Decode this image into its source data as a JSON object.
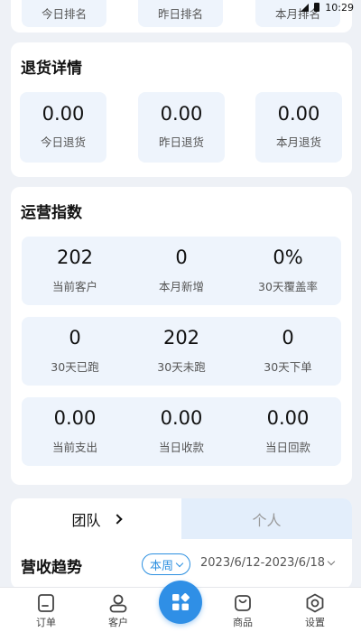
{
  "status_bar": {
    "time": "10:29"
  },
  "top_section": {
    "labels": [
      "今日排名",
      "昨日排名",
      "本月排名"
    ]
  },
  "returns": {
    "title": "退货详情",
    "items": [
      {
        "value": "0.00",
        "label": "今日退货"
      },
      {
        "value": "0.00",
        "label": "昨日退货"
      },
      {
        "value": "0.00",
        "label": "本月退货"
      }
    ]
  },
  "operations": {
    "title": "运营指数",
    "rows": [
      [
        {
          "value": "202",
          "label": "当前客户"
        },
        {
          "value": "0",
          "label": "本月新增"
        },
        {
          "value": "0%",
          "label": "30天覆盖率"
        }
      ],
      [
        {
          "value": "0",
          "label": "30天已跑"
        },
        {
          "value": "202",
          "label": "30天未跑"
        },
        {
          "value": "0",
          "label": "30天下单"
        }
      ],
      [
        {
          "value": "0.00",
          "label": "当前支出"
        },
        {
          "value": "0.00",
          "label": "当日收款"
        },
        {
          "value": "0.00",
          "label": "当日回款"
        }
      ]
    ]
  },
  "tabs": {
    "team": "团队",
    "personal": "个人"
  },
  "trend": {
    "title": "营收趋势",
    "period": "本周",
    "date_range": "2023/6/12-2023/6/18"
  },
  "nav": {
    "orders": "订单",
    "customers": "客户",
    "products": "商品",
    "settings": "设置"
  },
  "colors": {
    "accent": "#2f8fe6",
    "tile_bg": "#eef4fc",
    "page_bg": "#eef1f6"
  }
}
